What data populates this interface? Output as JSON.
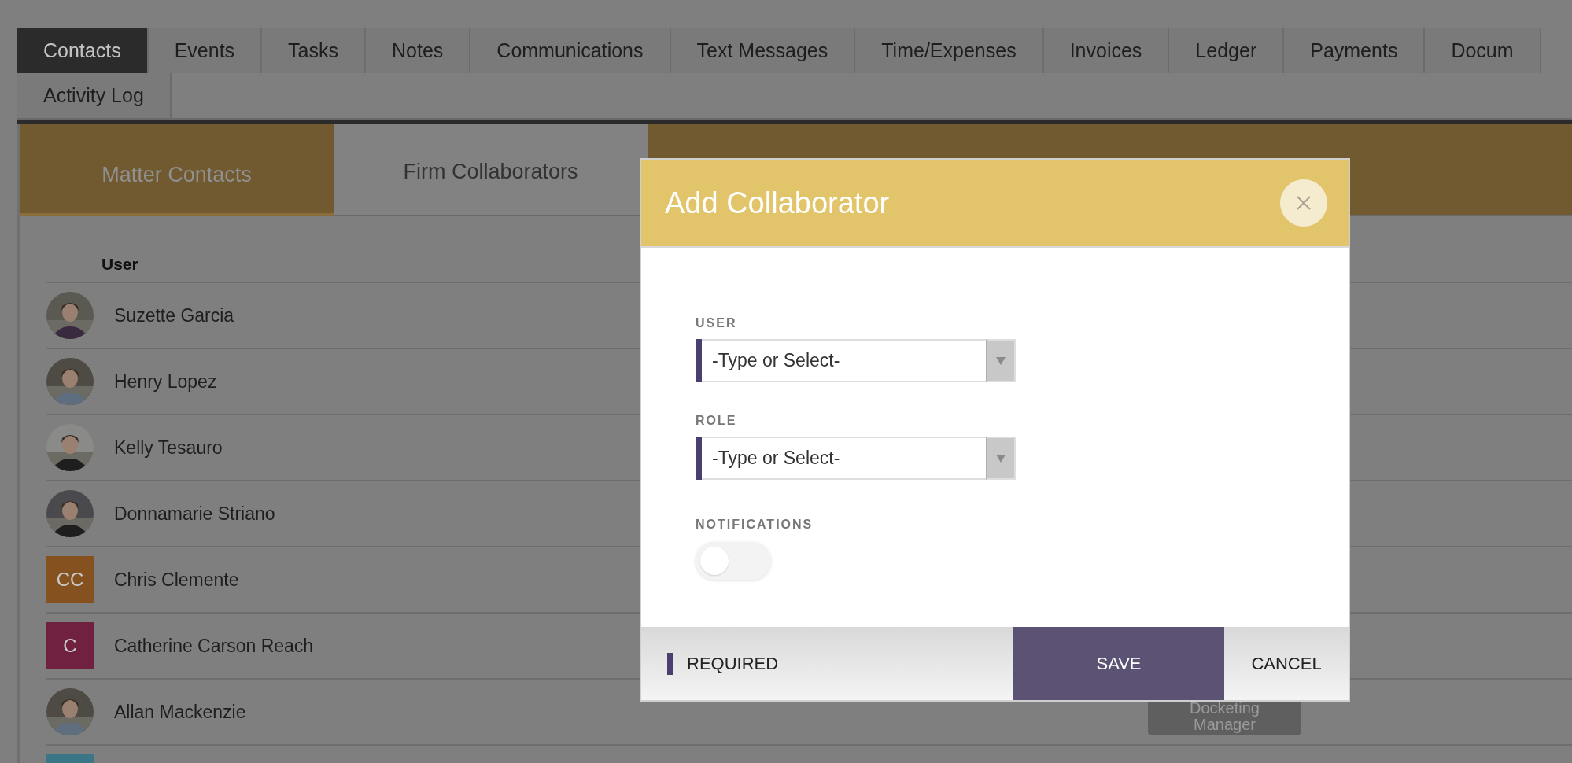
{
  "tab_rows": [
    {
      "tabs": [
        {
          "label": "Contacts",
          "selected": true
        },
        {
          "label": "Events",
          "selected": false
        },
        {
          "label": "Tasks",
          "selected": false
        },
        {
          "label": "Notes",
          "selected": false
        },
        {
          "label": "Communications",
          "selected": false
        },
        {
          "label": "Text Messages",
          "selected": false
        },
        {
          "label": "Time/Expenses",
          "selected": false
        },
        {
          "label": "Invoices",
          "selected": false
        },
        {
          "label": "Ledger",
          "selected": false
        },
        {
          "label": "Payments",
          "selected": false
        },
        {
          "label": "Docum",
          "selected": false
        }
      ]
    },
    {
      "tabs": [
        {
          "label": "Activity Log",
          "selected": false
        }
      ]
    }
  ],
  "sub_tabs": [
    {
      "label": "Matter Contacts",
      "selected": false
    },
    {
      "label": "Firm Collaborators",
      "selected": true
    }
  ],
  "table": {
    "columns": [
      "User"
    ],
    "rows": [
      {
        "name": "Suzette Garcia"
      },
      {
        "name": "Henry Lopez"
      },
      {
        "name": "Kelly Tesauro"
      },
      {
        "name": "Donnamarie Striano"
      },
      {
        "name": "Chris Clemente",
        "avatar": {
          "kind": "initials",
          "initials": "CC",
          "color": "#85521f"
        }
      },
      {
        "name": "Catherine Carson Reach",
        "avatar": {
          "kind": "initials",
          "initials": "C",
          "color": "#702140"
        }
      },
      {
        "name": "Allan Mackenzie",
        "role_badge": "Docketing Manager"
      },
      {
        "avatar": {
          "kind": "initials",
          "color": "#3b7686"
        }
      }
    ]
  },
  "modal": {
    "title": "Add Collaborator",
    "fields": [
      {
        "label": "USER",
        "placeholder": "-Type or Select-",
        "required": true
      },
      {
        "label": "ROLE",
        "placeholder": "-Type or Select-",
        "required": true
      }
    ],
    "toggle": {
      "label": "NOTIFICATIONS",
      "on": false
    },
    "required_legend": "REQUIRED",
    "buttons": [
      {
        "label": "SAVE",
        "kind": "primary"
      },
      {
        "label": "CANCEL",
        "kind": "secondary"
      }
    ]
  }
}
